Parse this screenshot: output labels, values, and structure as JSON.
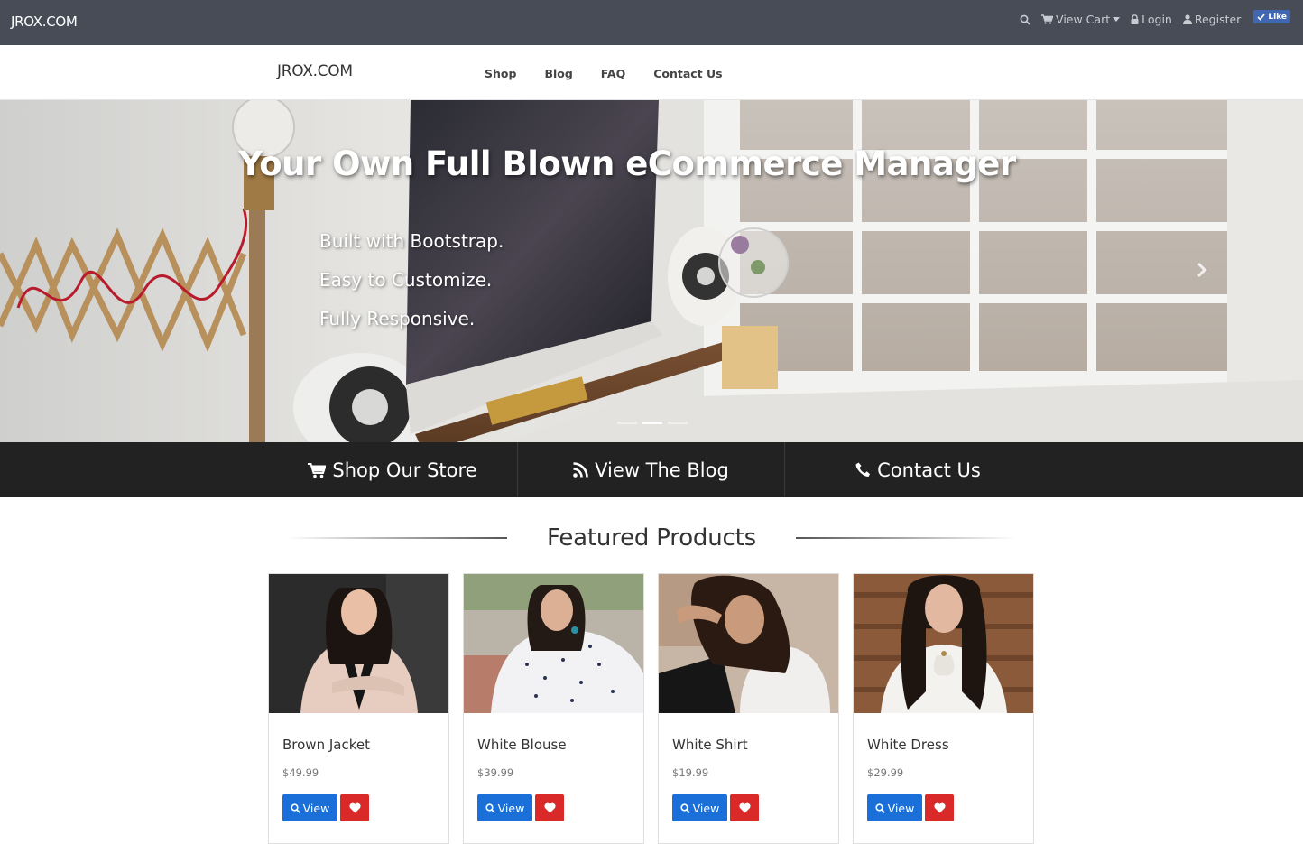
{
  "topbar": {
    "brand": "JROX.COM",
    "cart_label": "View Cart",
    "login_label": "Login",
    "register_label": "Register",
    "like_label": "Like"
  },
  "nav": {
    "logo": "JROX.COM",
    "links": [
      "Shop",
      "Blog",
      "FAQ",
      "Contact Us"
    ]
  },
  "hero": {
    "title": "Your Own Full Blown eCommerce Manager",
    "lines": [
      "Built with Bootstrap.",
      "Easy to Customize.",
      "Fully Responsive."
    ],
    "slide_count": 3,
    "active_slide": 1
  },
  "actions": [
    {
      "label": "Shop Our Store",
      "icon": "cart-icon"
    },
    {
      "label": "View The Blog",
      "icon": "rss-icon"
    },
    {
      "label": "Contact Us",
      "icon": "phone-icon"
    }
  ],
  "featured": {
    "heading": "Featured Products",
    "view_label": "View",
    "products": [
      {
        "name": "Brown Jacket",
        "price": "$49.99"
      },
      {
        "name": "White Blouse",
        "price": "$39.99"
      },
      {
        "name": "White Shirt",
        "price": "$19.99"
      },
      {
        "name": "White Dress",
        "price": "$29.99"
      }
    ]
  },
  "colors": {
    "topbar": "#474c57",
    "strip": "#222222",
    "primary_button": "#1b6fd8",
    "favorite_button": "#d92929",
    "facebook_blue": "#4267b2"
  }
}
